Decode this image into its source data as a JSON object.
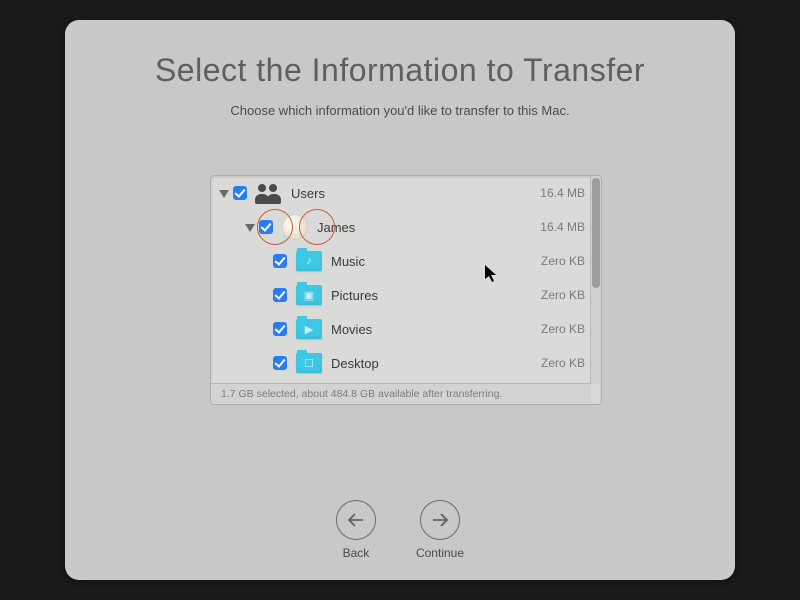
{
  "title": "Select the Information to Transfer",
  "subtitle": "Choose which information you'd like to transfer to this Mac.",
  "tree": {
    "users_label": "Users",
    "users_size": "16.4 MB",
    "james_label": "James",
    "james_size": "16.4 MB",
    "music_label": "Music",
    "music_size": "Zero KB",
    "pictures_label": "Pictures",
    "pictures_size": "Zero KB",
    "movies_label": "Movies",
    "movies_size": "Zero KB",
    "desktop_label": "Desktop",
    "desktop_size": "Zero KB"
  },
  "status": "1.7 GB selected, about 484.8 GB available after transferring.",
  "nav": {
    "back": "Back",
    "continue": "Continue"
  }
}
